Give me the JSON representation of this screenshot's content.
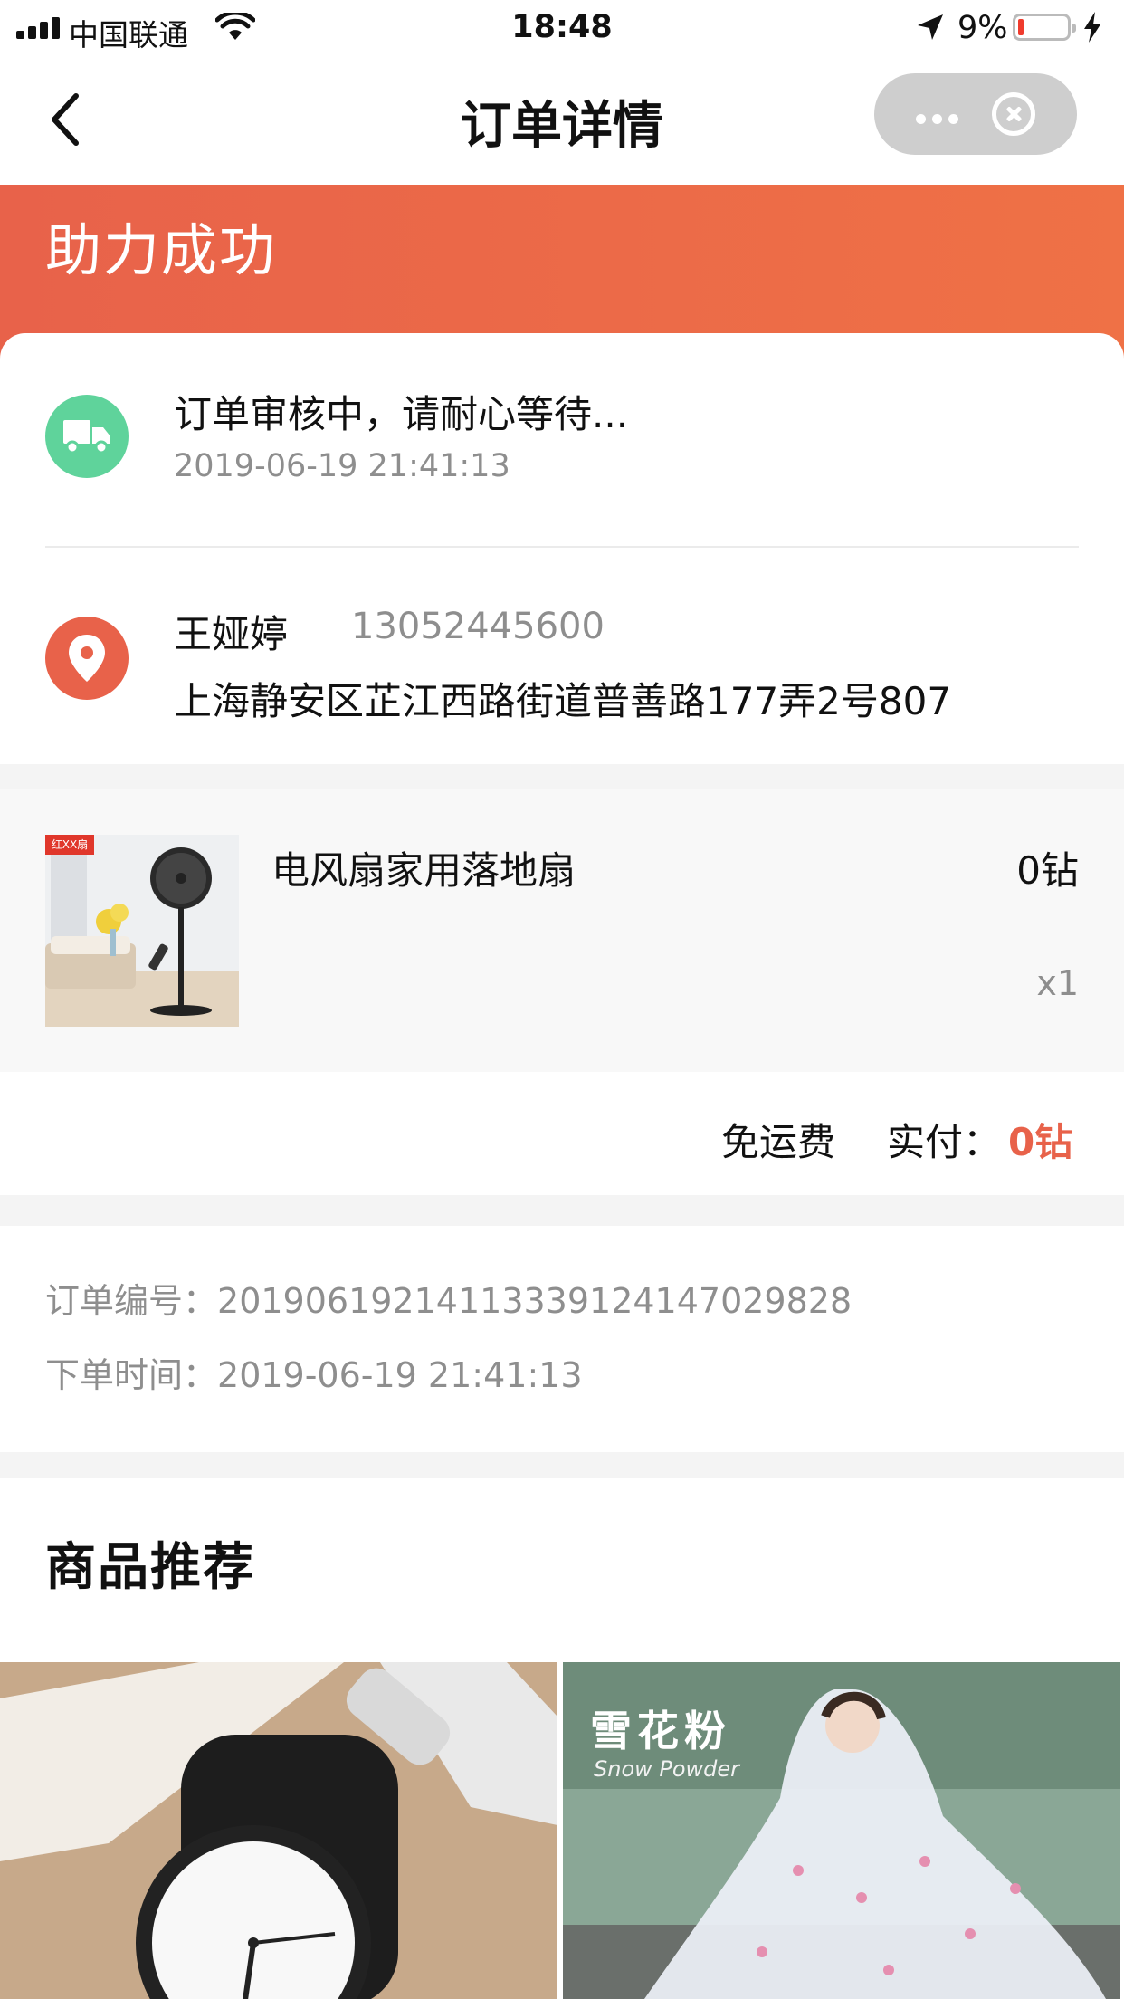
{
  "status_bar": {
    "carrier": "中国联通",
    "time": "18:48",
    "battery_percent": "9%"
  },
  "nav": {
    "title": "订单详情"
  },
  "banner": {
    "title": "助力成功"
  },
  "order_status": {
    "text": "订单审核中，请耐心等待...",
    "time": "2019-06-19 21:41:13"
  },
  "address": {
    "name": "王娅婷",
    "phone": "13052445600",
    "detail": "上海静安区芷江西路街道普善路177弄2号807"
  },
  "product": {
    "name": "电风扇家用落地扇",
    "price": "0钻",
    "quantity": "x1",
    "badge": "红XX扇"
  },
  "summary": {
    "shipping": "免运费",
    "paid_label": "实付：",
    "paid_value": "0钻"
  },
  "order_info": {
    "number_label": "订单编号：",
    "number": "20190619214113339124147029828",
    "time_label": "下单时间：",
    "time": "2019-06-19 21:41:13"
  },
  "recommend": {
    "title": "商品推荐",
    "items": [
      {
        "image": "casio-watch"
      },
      {
        "image": "raincoat",
        "overlay_title": "雪花粉",
        "overlay_subtitle": "Snow Powder"
      }
    ]
  },
  "colors": {
    "accent": "#E8624A",
    "truck_icon_bg": "#5FD39B",
    "muted_text": "#8E8E8E"
  }
}
